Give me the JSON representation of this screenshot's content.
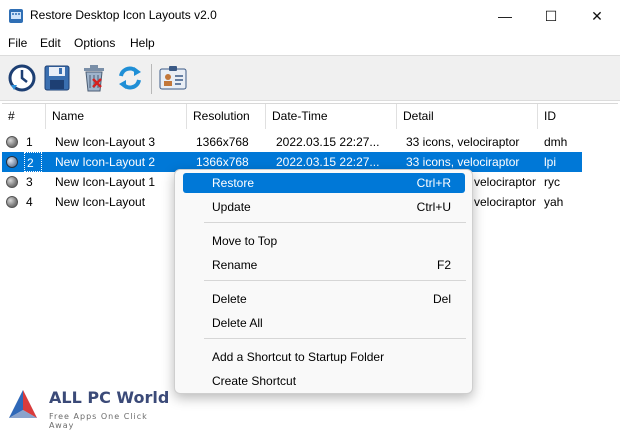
{
  "window": {
    "title": "Restore Desktop Icon Layouts v2.0",
    "minimize": "—",
    "maximize": "☐",
    "close": "✕"
  },
  "menu": [
    "File",
    "Edit",
    "Options",
    "Help"
  ],
  "toolbar": {
    "icons": [
      "restore-clock-icon",
      "save-disk-icon",
      "delete-trash-icon",
      "refresh-arrows-icon",
      "id-card-icon"
    ]
  },
  "table": {
    "columns": [
      "#",
      "Name",
      "Resolution",
      "Date-Time",
      "Detail",
      "ID"
    ],
    "rows": [
      {
        "num": "1",
        "name": "New Icon-Layout 3",
        "resolution": "1366x768",
        "datetime": "2022.03.15 22:27...",
        "detail": "33 icons, velociraptor",
        "id": "dmh",
        "selected": false
      },
      {
        "num": "2",
        "name": "New Icon-Layout 2",
        "resolution": "1366x768",
        "datetime": "2022.03.15 22:27...",
        "detail": "33 icons, velociraptor",
        "id": "lpi",
        "selected": true
      },
      {
        "num": "3",
        "name": "New Icon-Layout 1",
        "resolution": "",
        "datetime": "",
        "detail": "velociraptor",
        "id": "ryc",
        "selected": false
      },
      {
        "num": "4",
        "name": "New Icon-Layout",
        "resolution": "",
        "datetime": "",
        "detail": "velociraptor",
        "id": "yah",
        "selected": false
      }
    ]
  },
  "context_menu": {
    "items": [
      {
        "label": "Restore",
        "shortcut": "Ctrl+R"
      },
      {
        "label": "Update",
        "shortcut": "Ctrl+U"
      },
      {
        "label": "Move to Top",
        "shortcut": ""
      },
      {
        "label": "Rename",
        "shortcut": "F2"
      },
      {
        "label": "Delete",
        "shortcut": "Del"
      },
      {
        "label": "Delete All",
        "shortcut": ""
      },
      {
        "label": "Add a Shortcut to Startup Folder",
        "shortcut": ""
      },
      {
        "label": "Create Shortcut",
        "shortcut": ""
      }
    ]
  },
  "watermark": {
    "title": "ALL PC World",
    "subtitle": "Free Apps One Click Away"
  },
  "colors": {
    "selection": "#0078d7",
    "toolbar_bg": "#f0f0f0",
    "menu_bg": "#f9f9f9"
  }
}
